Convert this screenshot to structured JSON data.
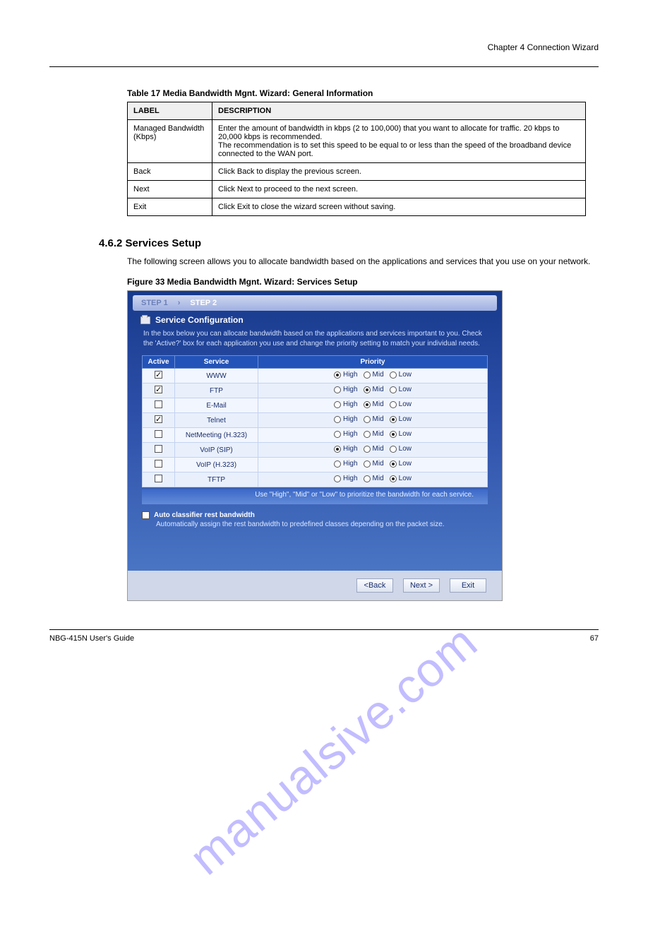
{
  "chapter_title": "Chapter 4 Connection Wizard",
  "table_title": "Table 17   Media Bandwidth Mgnt. Wizard: General Information",
  "doc_table": {
    "headers": [
      "LABEL",
      "DESCRIPTION"
    ],
    "rows": [
      [
        "Managed Bandwidth (Kbps)",
        "Enter the amount of bandwidth in kbps (2 to 100,000) that you want to allocate for traffic. 20 kbps to 20,000 kbps is recommended.\nThe recommendation is to set this speed to be equal to or less than the speed of the broadband device connected to the WAN port."
      ],
      [
        "Back",
        "Click Back to display the previous screen."
      ],
      [
        "Next",
        "Click Next to proceed to the next screen."
      ],
      [
        "Exit",
        "Click Exit to close the wizard screen without saving."
      ]
    ]
  },
  "section_number": "4.6.2  Services Setup",
  "section_desc": "The following screen allows you to allocate bandwidth based on the applications and services that you use on your network.",
  "figure_caption": "Figure 33   Media Bandwidth Mgnt. Wizard: Services Setup",
  "shot": {
    "step1": "STEP 1",
    "sep": "›",
    "step2": "STEP 2",
    "panel_title": "Service Configuration",
    "panel_desc": "In the box below you can allocate bandwidth based on the applications and services important to you. Check the 'Active?' box for each application you use and change the priority setting to match your individual needs.",
    "cols": {
      "active": "Active",
      "service": "Service",
      "priority": "Priority"
    },
    "prio_labels": {
      "high": "High",
      "mid": "Mid",
      "low": "Low"
    },
    "rows": [
      {
        "active": true,
        "service": "WWW",
        "priority": "High"
      },
      {
        "active": true,
        "service": "FTP",
        "priority": "Mid"
      },
      {
        "active": false,
        "service": "E-Mail",
        "priority": "Mid"
      },
      {
        "active": true,
        "service": "Telnet",
        "priority": "Low"
      },
      {
        "active": false,
        "service": "NetMeeting (H.323)",
        "priority": "Low"
      },
      {
        "active": false,
        "service": "VoIP (SIP)",
        "priority": "High"
      },
      {
        "active": false,
        "service": "VoIP (H.323)",
        "priority": "Low"
      },
      {
        "active": false,
        "service": "TFTP",
        "priority": "Low"
      }
    ],
    "table_hint": "Use \"High\", \"Mid\" or \"Low\" to prioritize the bandwidth for each service.",
    "auto_title": "Auto classifier rest bandwidth",
    "auto_sub": "Automatically assign the rest bandwidth to predefined classes depending on the packet size.",
    "buttons": {
      "back": "<Back",
      "next": "Next >",
      "exit": "Exit"
    }
  },
  "footer": {
    "left": "NBG-415N User's Guide",
    "right": "67"
  },
  "watermark": "manualsive.com"
}
